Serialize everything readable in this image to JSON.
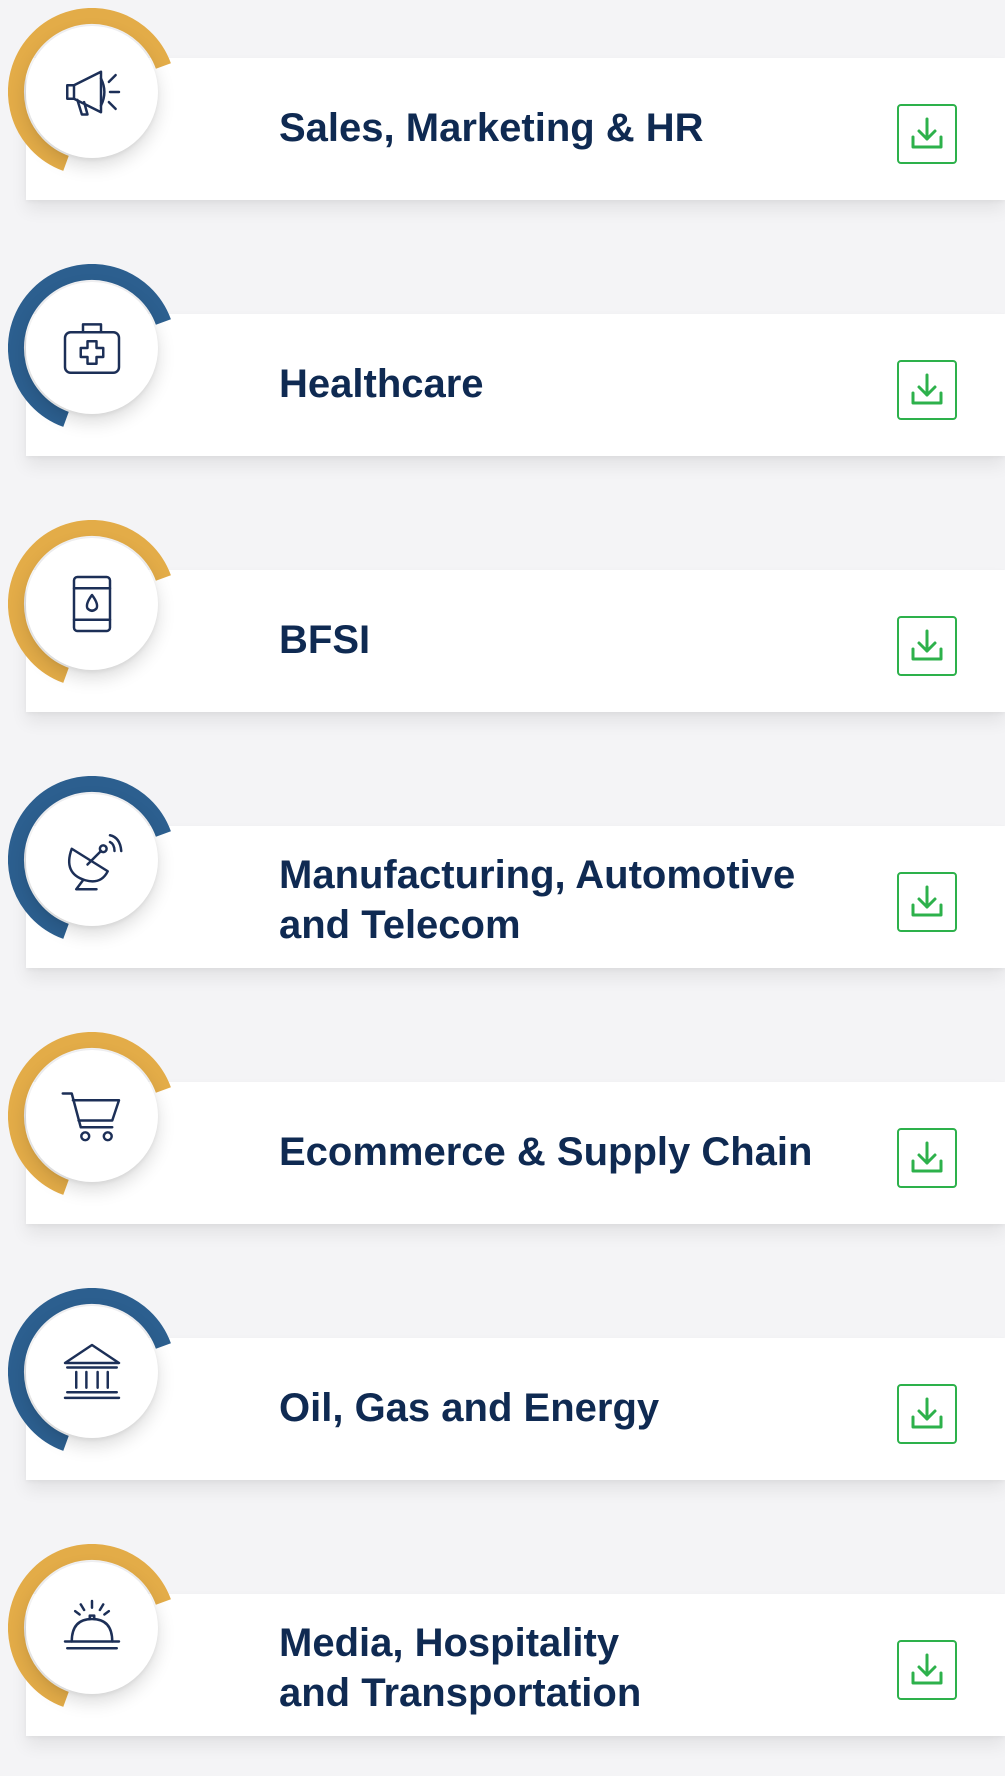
{
  "colors": {
    "gold": "#e3ac48",
    "blue": "#2c5f8f",
    "navy": "#0f2a52",
    "green": "#2db14b",
    "icon_stroke": "#1c2f57"
  },
  "industries": [
    {
      "icon": "megaphone-icon",
      "ring": "gold",
      "lines": [
        "Sales, Marketing  & HR"
      ]
    },
    {
      "icon": "medical-kit-icon",
      "ring": "blue",
      "lines": [
        "Healthcare"
      ]
    },
    {
      "icon": "oil-barrel-icon",
      "ring": "gold",
      "lines": [
        "BFSI"
      ]
    },
    {
      "icon": "satellite-dish-icon",
      "ring": "blue",
      "lines": [
        "Manufacturing, Automotive",
        "and Telecom"
      ]
    },
    {
      "icon": "shopping-cart-icon",
      "ring": "gold",
      "lines": [
        "Ecommerce & Supply Chain"
      ]
    },
    {
      "icon": "bank-building-icon",
      "ring": "blue",
      "lines": [
        "Oil, Gas and Energy"
      ]
    },
    {
      "icon": "service-bell-icon",
      "ring": "gold",
      "lines": [
        "Media, Hospitality",
        "and Transportation"
      ]
    }
  ],
  "download_icon": "download-icon"
}
